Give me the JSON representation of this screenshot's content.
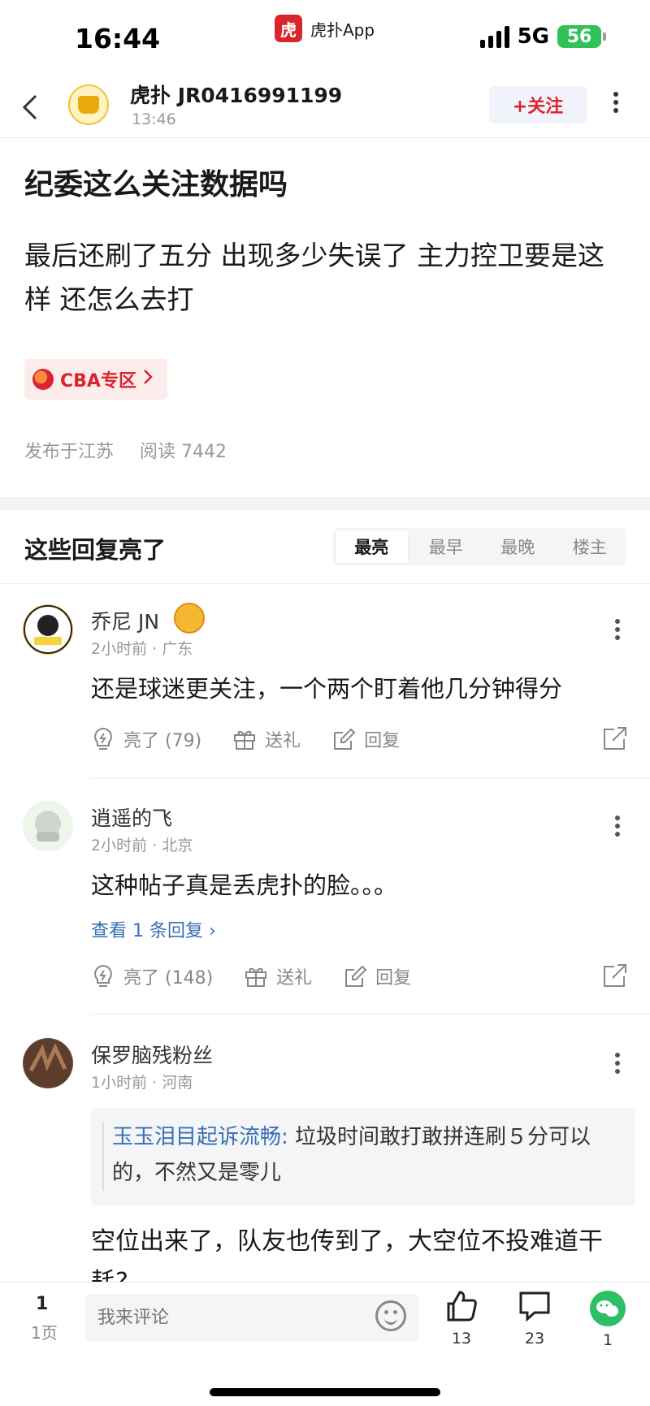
{
  "status_bar": {
    "time": "16:44",
    "app_logo_char": "虎扑",
    "app_name": "虎扑App",
    "network": "5G",
    "battery": "56"
  },
  "header": {
    "user_name": "虎扑 JR0416991199",
    "time": "13:46",
    "follow_label": "+关注"
  },
  "post": {
    "title": "纪委这么关注数据吗",
    "body": "最后还刷了五分 出现多少失误了 主力控卫要是这样 还怎么去打",
    "zone_label": "CBA专区",
    "location": "发布于江苏",
    "reads": "阅读 7442"
  },
  "replies_header": {
    "title": "这些回复亮了",
    "tabs": [
      "最亮",
      "最早",
      "最晚",
      "楼主"
    ]
  },
  "comments": [
    {
      "name": "乔尼 JN",
      "meta": "2小时前 · 广东",
      "text": "还是球迷更关注，一个两个盯着他几分钟得分",
      "light_label": "亮了 (79)",
      "gift_label": "送礼",
      "reply_label": "回复"
    },
    {
      "name": "逍遥的飞",
      "meta": "2小时前 · 北京",
      "text": "这种帖子真是丢虎扑的脸。。。",
      "view_replies": "查看 1 条回复 ›",
      "light_label": "亮了 (148)",
      "gift_label": "送礼",
      "reply_label": "回复"
    },
    {
      "name": "保罗脑残粉丝",
      "meta": "1小时前 · 河南",
      "quote_author": "玉玉泪目起诉流畅:",
      "quote_text": " 垃圾时间敢打敢拼连刷５分可以的，不然又是零儿",
      "text": "空位出来了，队友也传到了，大空位不投难道干耗?"
    }
  ],
  "bottom_bar": {
    "page_num": "1",
    "page_unit": "1页",
    "input_placeholder": "我来评论",
    "likes": "13",
    "comments": "23",
    "shares": "1"
  }
}
